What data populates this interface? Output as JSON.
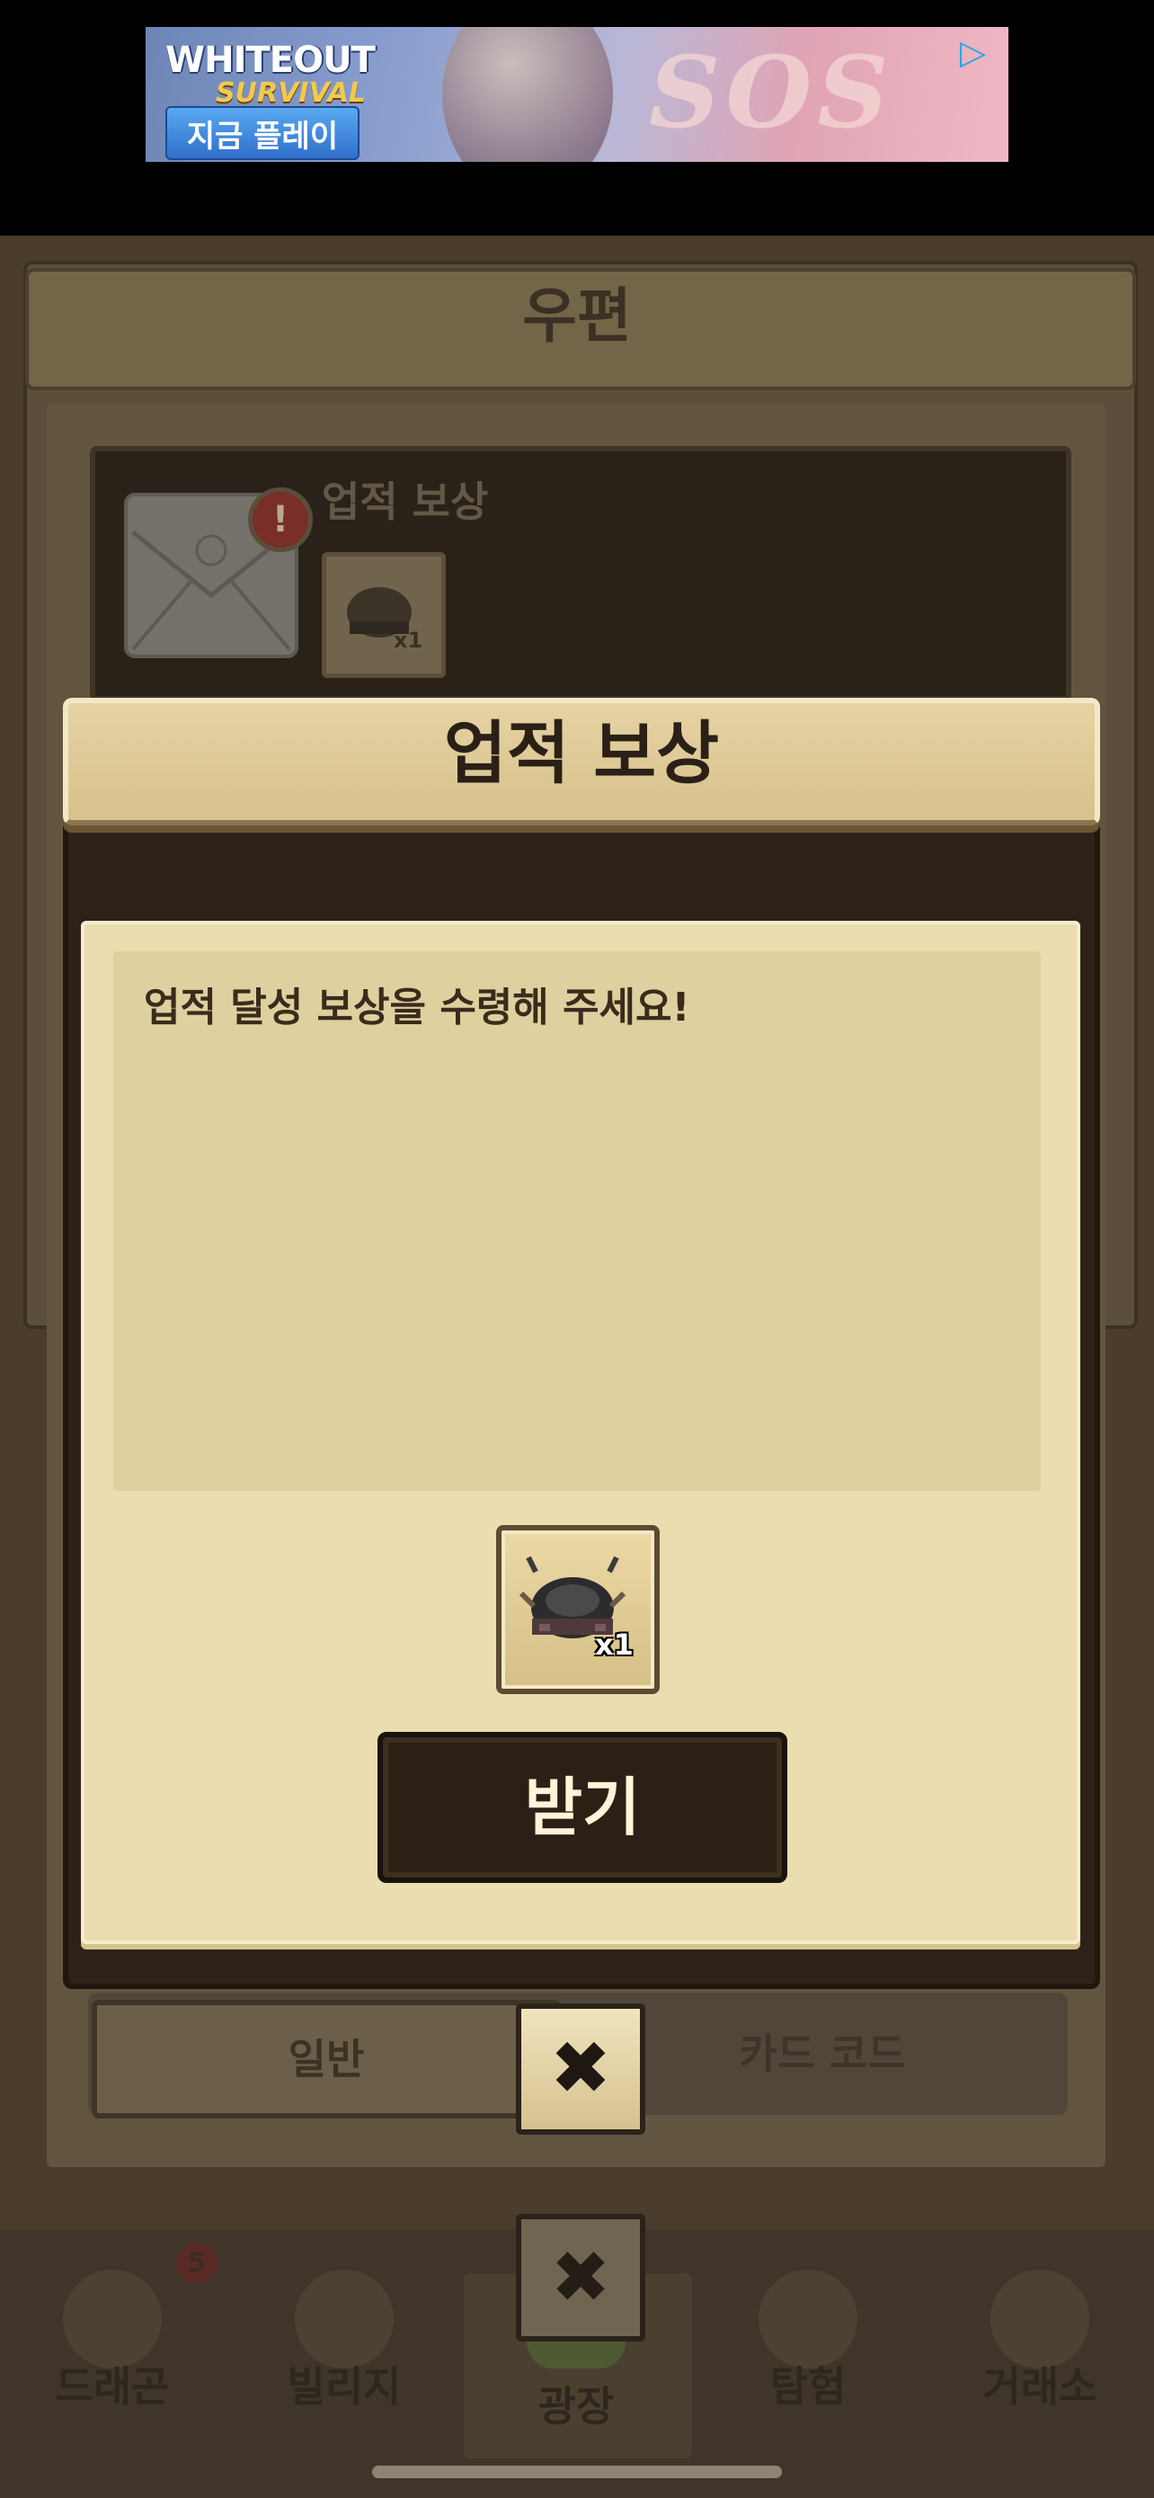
{
  "ad": {
    "logo_line1": "WHITEOUT",
    "logo_line2": "SURVIVAL",
    "cta_label": "지금 플레이",
    "sos_text": "SOS"
  },
  "mail": {
    "title": "우편",
    "item": {
      "title": "업적 보상",
      "reward_qty": "x1"
    },
    "tabs": [
      "일반",
      "카드 코드"
    ]
  },
  "dialog": {
    "title": "업적 보상",
    "message": "업적 달성 보상을 수령해 주세요!",
    "reward_qty": "x1",
    "receive_label": "받기",
    "close_label": "✖"
  },
  "bottom_nav": {
    "items": [
      {
        "label": "드래곤",
        "badge": "5"
      },
      {
        "label": "빌리지"
      },
      {
        "label": "광장"
      },
      {
        "label": "탐험"
      },
      {
        "label": "거래소"
      }
    ],
    "close_label": "✖"
  },
  "colors": {
    "dialog_header": "#e6d3a3",
    "dialog_content": "#ebddb0",
    "button_dark": "#2b2015",
    "overlay": "#4a3d2c"
  }
}
